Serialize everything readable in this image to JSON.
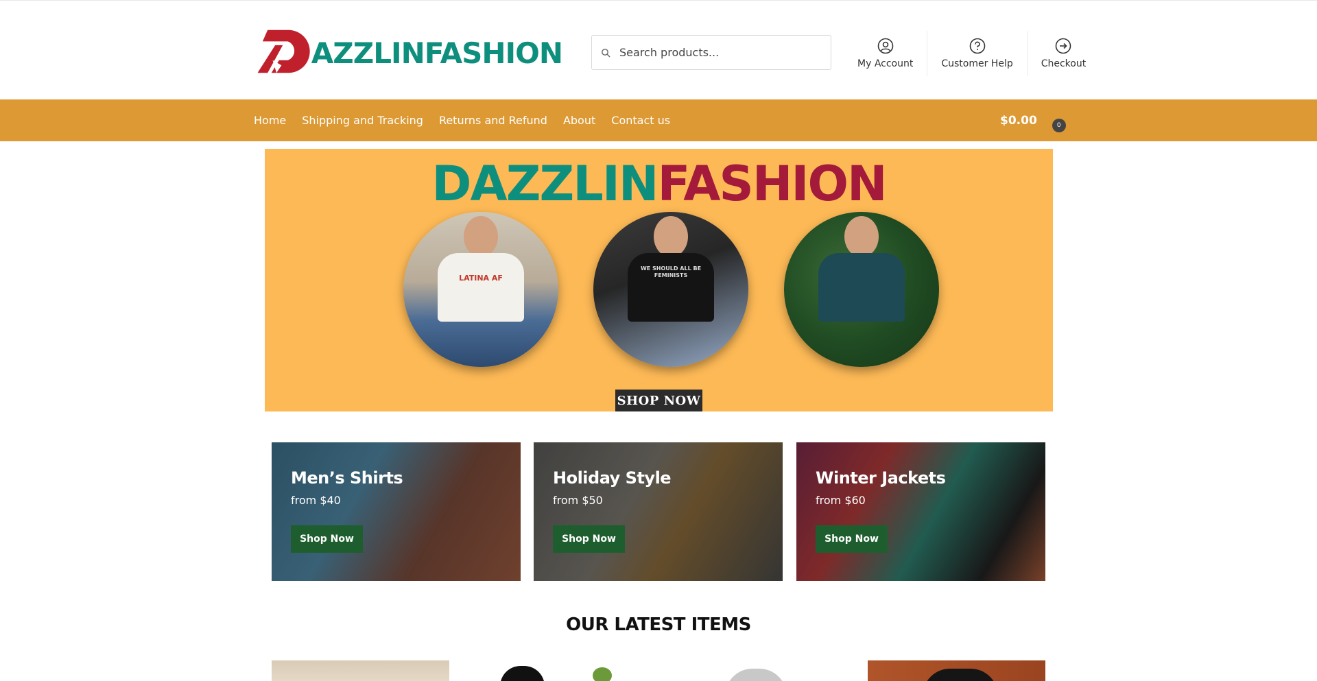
{
  "brand": {
    "logo_text": "AZZLINFASHION",
    "logo_letter": "D"
  },
  "search": {
    "placeholder": "Search products..."
  },
  "header_links": [
    {
      "label": "My Account",
      "icon": "user-circle-icon"
    },
    {
      "label": "Customer Help",
      "icon": "question-circle-icon"
    },
    {
      "label": "Checkout",
      "icon": "arrow-circle-right-icon"
    }
  ],
  "nav": {
    "items": [
      "Home",
      "Shipping and Tracking",
      "Returns and Refund",
      "About",
      "Contact us"
    ]
  },
  "cart": {
    "total": "$0.00",
    "count": "0"
  },
  "hero": {
    "title_part1": "DAZZLIN",
    "title_part2": "FASHION",
    "shirt1_text": "LATINA AF",
    "shirt2_text": "WE SHOULD ALL BE FEMINISTS",
    "cta": "SHOP NOW"
  },
  "categories": [
    {
      "title": "Men’s Shirts",
      "subtitle": "from $40",
      "button": "Shop Now"
    },
    {
      "title": "Holiday Style",
      "subtitle": "from $50",
      "button": "Shop Now"
    },
    {
      "title": "Winter Jackets",
      "subtitle": "from $60",
      "button": "Shop Now"
    }
  ],
  "latest": {
    "title": "OUR LATEST ITEMS"
  },
  "colors": {
    "nav_bg": "#dd9933",
    "brand_teal": "#0e8f7e",
    "brand_red": "#a31a3a",
    "hero_bg": "#fdb956",
    "button_green": "#1e5e2e"
  }
}
